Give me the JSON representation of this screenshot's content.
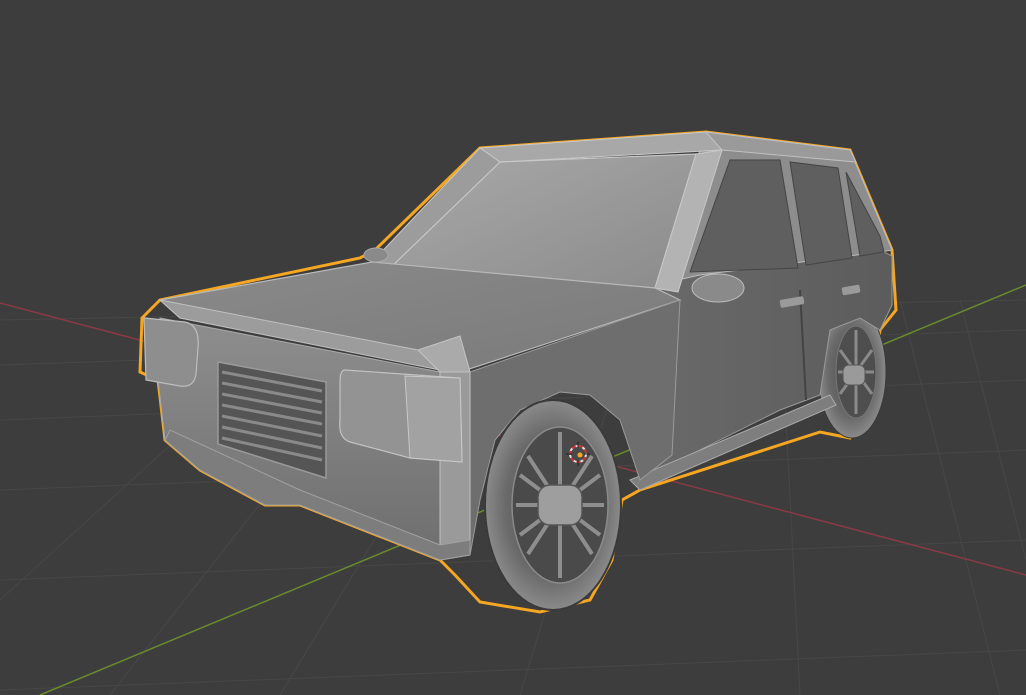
{
  "scene": {
    "background_color": "#3d3d3d",
    "grid_color": "#4a4a4a",
    "x_axis_color": "#8a3a46",
    "y_axis_color": "#6a8a2e",
    "selection_outline_color": "#f5a623",
    "object_shading": "solid-gray",
    "selected_object": "car",
    "origin_marker": "3d-cursor"
  }
}
